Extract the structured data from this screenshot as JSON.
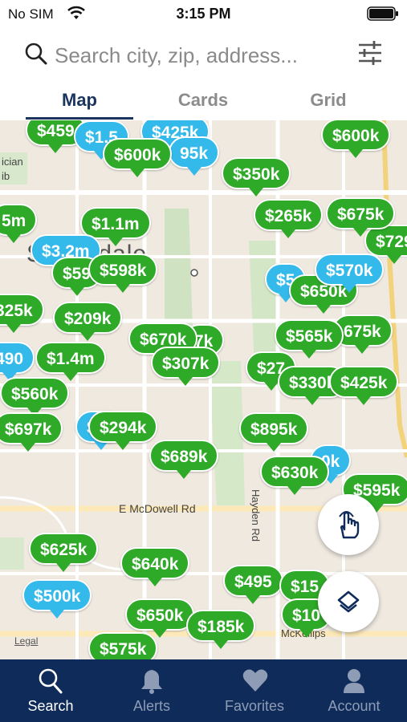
{
  "status_bar": {
    "carrier": "No SIM",
    "time": "3:15 PM"
  },
  "search": {
    "placeholder": "Search city, zip, address...",
    "value": ""
  },
  "tabs": [
    {
      "label": "Map",
      "active": true
    },
    {
      "label": "Cards",
      "active": false
    },
    {
      "label": "Grid",
      "active": false
    }
  ],
  "map": {
    "city_label": "Scottsdale",
    "street_labels": [
      "E McDowell Rd",
      "Hayden Rd",
      "McKellips"
    ],
    "partial_labels": [
      "ician",
      "ib"
    ],
    "legal": "Legal",
    "pins": {
      "p1": "$459",
      "p2": "$1.5",
      "p3": "$425k",
      "p4": "$600k",
      "p5": "95k",
      "p6": "$600k",
      "p7": "$350k",
      "p8": "5m",
      "p9": "$1.1m",
      "p10": "$265k",
      "p11": "$675k",
      "p12": "$729",
      "p13": "$3.2m",
      "p14": "$59",
      "p15": "$598k",
      "p16": "$570k",
      "p17": "$5",
      "p18": "$650k",
      "p19": "325k",
      "p20": "$209k",
      "p21": "$670k",
      "p22": "7k",
      "p23": "$565k",
      "p24": "675k",
      "p25": "$1.4m",
      "p26": "$307k",
      "p27": "$27",
      "p28": "490",
      "p29": "$330k",
      "p30": "$425k",
      "p31": "$560k",
      "p32": "$697k",
      "p33": "$294k",
      "p34": "$895k",
      "p35": "$71",
      "p36": "$689k",
      "p37": "$630k",
      "p38": "0k",
      "p39": "$595k",
      "p40": "$625k",
      "p41": "$640k",
      "p42": "$500k",
      "p43": "$495",
      "p44": "$15",
      "p45": "$650k",
      "p46": "$185k",
      "p47": "$10",
      "p48": "$575k"
    }
  },
  "bottom_nav": [
    {
      "label": "Search",
      "icon": "search-icon",
      "active": true
    },
    {
      "label": "Alerts",
      "icon": "bell-icon",
      "active": false
    },
    {
      "label": "Favorites",
      "icon": "heart-icon",
      "active": false
    },
    {
      "label": "Account",
      "icon": "person-icon",
      "active": false
    }
  ],
  "colors": {
    "pin_green": "#2fa928",
    "pin_blue": "#33b9ea",
    "nav_bar": "#0f2b59",
    "active_tab": "#1b355e",
    "map_bg": "#efe9e0"
  }
}
